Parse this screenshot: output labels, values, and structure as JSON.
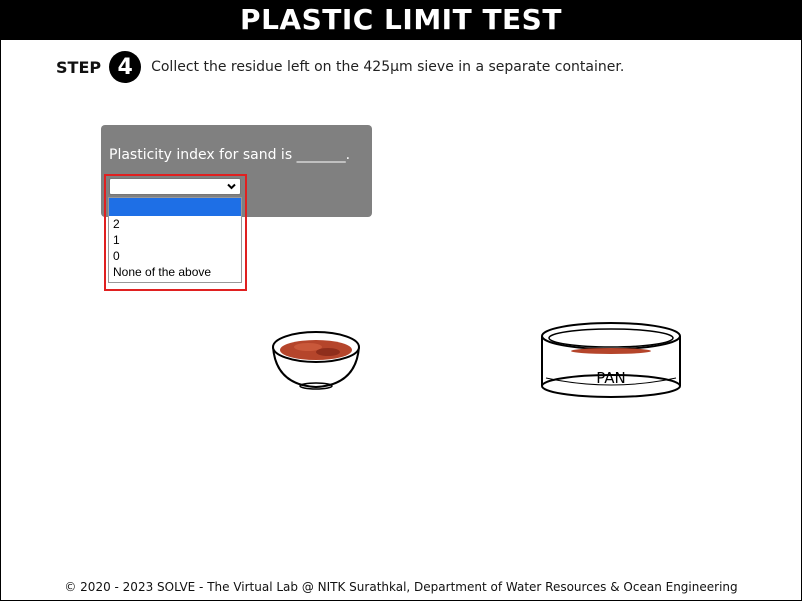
{
  "title": "PLASTIC LIMIT TEST",
  "step": {
    "label": "STEP",
    "number": "4",
    "instruction": "Collect the residue left on the 425µm sieve in a separate container."
  },
  "quiz": {
    "question": "Plasticity index for sand is _______.",
    "selected": "",
    "options": [
      "",
      "2",
      "1",
      "0",
      "None of the above"
    ]
  },
  "pan_label": "PAN",
  "footer": "© 2020 - 2023 SOLVE - The Virtual Lab @ NITK Surathkal, Department of Water Resources & Ocean Engineering",
  "colors": {
    "header_bg": "#000000",
    "quiz_bg": "#808080",
    "highlight": "#e02020",
    "selected_option": "#1e6fe6",
    "soil": "#b5452b"
  },
  "icons": {
    "select": "chevron-down-icon"
  }
}
